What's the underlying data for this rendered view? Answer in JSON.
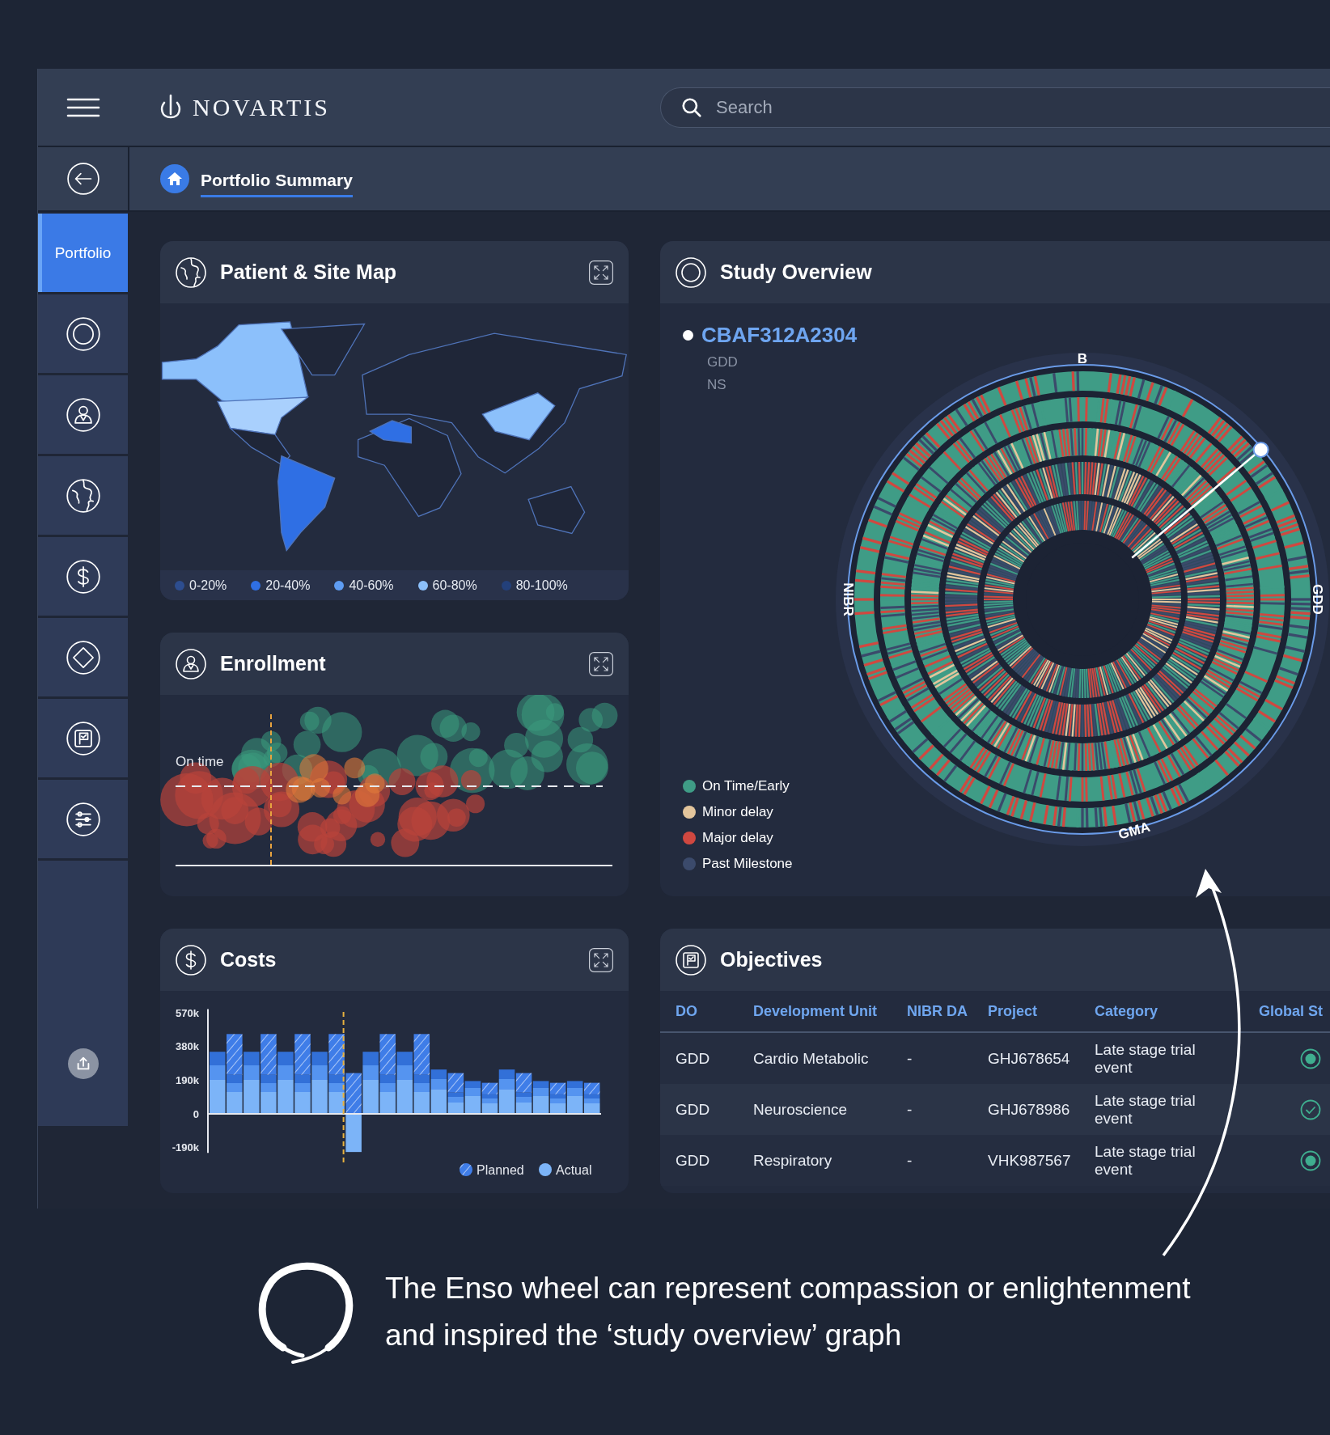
{
  "header": {
    "logo": "NOVARTIS",
    "search": {
      "placeholder": "Search"
    }
  },
  "breadcrumb": {
    "title": "Portfolio Summary"
  },
  "sidebar": {
    "items": [
      {
        "kind": "text",
        "label": "Portfolio",
        "selected": true
      },
      {
        "kind": "target",
        "selected": false
      },
      {
        "kind": "person",
        "selected": false
      },
      {
        "kind": "globe",
        "selected": false
      },
      {
        "kind": "dollar",
        "selected": false
      },
      {
        "kind": "diamond",
        "selected": false
      },
      {
        "kind": "flag",
        "selected": false
      },
      {
        "kind": "sliders",
        "selected": false
      }
    ]
  },
  "patient_site_map": {
    "title": "Patient & Site Map",
    "legend": [
      {
        "label": "0-20%",
        "color": "#2d4d8f"
      },
      {
        "label": "20-40%",
        "color": "#2f6fe4"
      },
      {
        "label": "40-60%",
        "color": "#5e9cf2"
      },
      {
        "label": "60-80%",
        "color": "#8cc0fb"
      },
      {
        "label": "80-100%",
        "color": "#23407a"
      }
    ]
  },
  "enrollment": {
    "title": "Enrollment",
    "reference_label": "On time"
  },
  "costs": {
    "title": "Costs",
    "chart_data": {
      "type": "bar",
      "stacked": true,
      "ylim": [
        -220,
        590
      ],
      "legend": "lower right",
      "yticks": [
        {
          "value": 570,
          "label": "570k"
        },
        {
          "value": 380,
          "label": "380k"
        },
        {
          "value": 190,
          "label": "190k"
        },
        {
          "value": 0,
          "label": "0"
        },
        {
          "value": -190,
          "label": "-190k"
        }
      ],
      "series": [
        {
          "name": "Actual",
          "color": "#7cb4f8",
          "values": [
            350,
            220,
            350,
            220,
            350,
            220,
            350,
            220,
            -215,
            350,
            220,
            350,
            220,
            250,
            120,
            185,
            110,
            250,
            120,
            185,
            110,
            185,
            110
          ]
        },
        {
          "name": "Planned",
          "color": "#3f7de8",
          "values": [
            null,
            230,
            null,
            230,
            null,
            230,
            null,
            230,
            230,
            null,
            230,
            null,
            230,
            null,
            110,
            null,
            65,
            null,
            110,
            null,
            65,
            null,
            65
          ]
        }
      ]
    }
  },
  "study_overview": {
    "title": "Study Overview",
    "study": {
      "id": "CBAF312A2304",
      "lines": [
        "GDD",
        "NS"
      ]
    },
    "segments": [
      "B",
      "GDD",
      "NIBR",
      "GMA"
    ],
    "legend": [
      {
        "label": "On Time/Early",
        "color": "#3f9c86"
      },
      {
        "label": "Minor delay",
        "color": "#e3c59c"
      },
      {
        "label": "Major delay",
        "color": "#d04840"
      },
      {
        "label": "Past Milestone",
        "color": "#3b4a6b"
      }
    ]
  },
  "objectives": {
    "title": "Objectives",
    "columns": [
      "DO",
      "Development Unit",
      "NIBR DA",
      "Project",
      "Category",
      "Global St"
    ],
    "rows": [
      {
        "cells": [
          "GDD",
          "Cardio Metabolic",
          "-",
          "GHJ678654",
          "Late stage trial event"
        ],
        "kind": "dot"
      },
      {
        "cells": [
          "GDD",
          "Neuroscience",
          "-",
          "GHJ678986",
          "Late stage trial event"
        ],
        "kind": "check"
      },
      {
        "cells": [
          "GDD",
          "Respiratory",
          "-",
          "VHK987567",
          "Late stage trial event"
        ],
        "kind": "dot"
      }
    ]
  },
  "caption": {
    "lines": [
      "The Enso wheel can represent compassion or enlightenment",
      "and inspired the ‘study overview’ graph"
    ]
  }
}
